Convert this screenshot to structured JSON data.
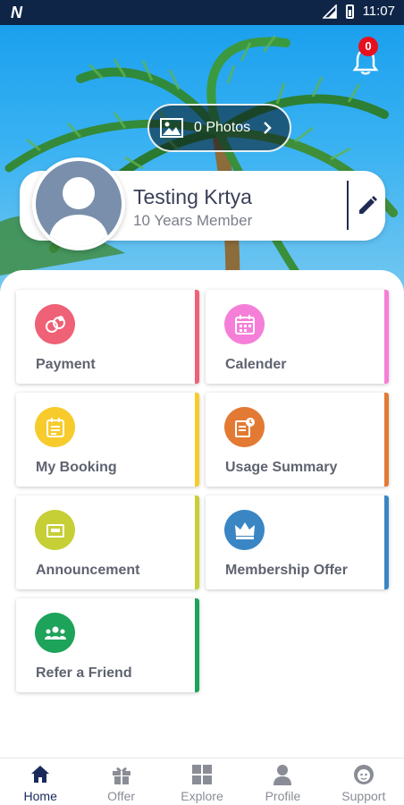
{
  "status_bar": {
    "time": "11:07",
    "carrier_logo": "N"
  },
  "header": {
    "notification_count": "0",
    "photos_label": "0 Photos"
  },
  "profile": {
    "name": "Testing Krtya",
    "membership": "10 Years Member"
  },
  "tiles": [
    {
      "label": "Payment",
      "icon": "payment-icon",
      "circle_color": "#ef6176",
      "accent_color": "#ef6176"
    },
    {
      "label": "Calender",
      "icon": "calendar-icon",
      "circle_color": "#f57fd8",
      "accent_color": "#f57fd8"
    },
    {
      "label": "My Booking",
      "icon": "booking-icon",
      "circle_color": "#f7cb2c",
      "accent_color": "#f7cb2c"
    },
    {
      "label": "Usage Summary",
      "icon": "usage-summary-icon",
      "circle_color": "#e37a34",
      "accent_color": "#e37a34"
    },
    {
      "label": "Announcement",
      "icon": "announcement-icon",
      "circle_color": "#c6cf36",
      "accent_color": "#c6cf36"
    },
    {
      "label": "Membership Offer",
      "icon": "crown-icon",
      "circle_color": "#3a86c4",
      "accent_color": "#3a86c4"
    },
    {
      "label": "Refer a Friend",
      "icon": "group-icon",
      "circle_color": "#1da35a",
      "accent_color": "#1da35a"
    }
  ],
  "bottom_nav": [
    {
      "label": "Home",
      "icon": "home-icon",
      "active": true
    },
    {
      "label": "Offer",
      "icon": "gift-icon",
      "active": false
    },
    {
      "label": "Explore",
      "icon": "grid-icon",
      "active": false
    },
    {
      "label": "Profile",
      "icon": "person-icon",
      "active": false
    },
    {
      "label": "Support",
      "icon": "support-icon",
      "active": false
    }
  ],
  "colors": {
    "primary_dark": "#0f2548",
    "nav_active": "#1a2a5a",
    "badge": "#e8101e"
  }
}
